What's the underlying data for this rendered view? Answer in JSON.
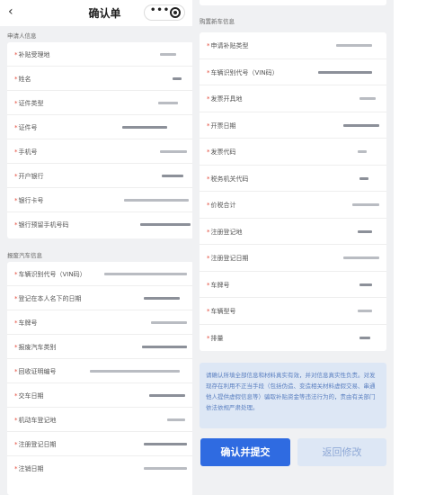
{
  "navbar": {
    "title": "确认单",
    "back_icon": "chevron-left-icon",
    "more_icon": "more-dots-icon",
    "target_icon": "target-icon"
  },
  "applicant": {
    "section_title": "申请人信息",
    "fields": [
      "补贴受理地",
      "姓名",
      "证件类型",
      "证件号",
      "手机号",
      "开户银行",
      "银行卡号",
      "银行预留手机号码"
    ]
  },
  "scrap_vehicle": {
    "section_title": "报废汽车信息",
    "fields": [
      "车辆识别代号（VIN码）",
      "登记在本人名下的日期",
      "车牌号",
      "报废汽车类别",
      "回收证明编号",
      "交车日期",
      "机动车登记地",
      "注册登记日期",
      "注销日期"
    ]
  },
  "new_vehicle": {
    "section_title": "购置新车信息",
    "fields": [
      "申请补贴类型",
      "车辆识别代号（VIN码）",
      "发票开具地",
      "开票日期",
      "发票代码",
      "税务机关代码",
      "价税合计",
      "注册登记地",
      "注册登记日期",
      "车牌号",
      "车辆型号",
      "排量"
    ]
  },
  "notice": "请确认所填全部信息和材料真实有效，并对信息真实性负责。对发现存在利用不正当手段（包括伪造、变造相关材料虚假交易、串通他人提供虚假信息等）骗取补贴资金等违法行为的，责由有关部门依法依规严肃处理。",
  "buttons": {
    "submit": "确认并提交",
    "back": "返回修改"
  }
}
